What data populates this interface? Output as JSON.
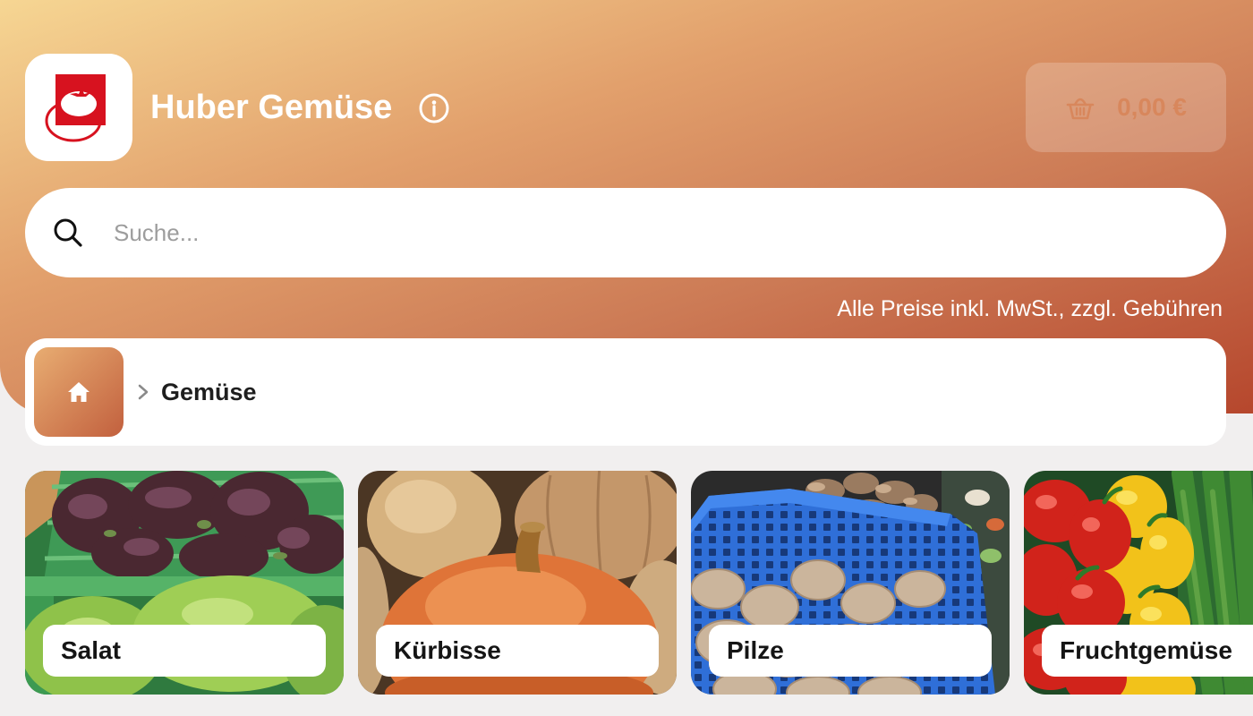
{
  "shop": {
    "name": "Huber Gemüse",
    "logo_icon": "tomato-logo",
    "info_icon": "info-icon"
  },
  "cart": {
    "total": "0,00 €",
    "icon": "basket-icon"
  },
  "search": {
    "placeholder": "Suche...",
    "value": "",
    "icon": "search-icon"
  },
  "price_note": "Alle Preise inkl. MwSt., zzgl. Gebühren",
  "breadcrumb": {
    "home_icon": "home-icon",
    "separator_icon": "chevron-right-icon",
    "current": "Gemüse"
  },
  "categories": [
    {
      "label": "Salat"
    },
    {
      "label": "Kürbisse"
    },
    {
      "label": "Pilze"
    },
    {
      "label": "Fruchtgemüse"
    }
  ],
  "colors": {
    "header_gradient_start": "#f6d693",
    "header_gradient_end": "#b6472d",
    "page_background": "#f1efef",
    "logo_red": "#d7121f",
    "cart_text": "#d8875c",
    "text_dark": "#1e1e1e",
    "placeholder": "#9d9d9d"
  }
}
